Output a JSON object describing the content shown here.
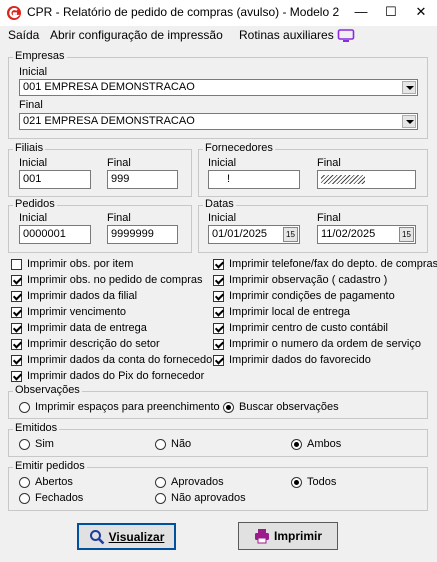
{
  "window": {
    "title": "CPR - Relatório de pedido de compras (avulso) - Modelo 2",
    "minimize": "—",
    "maximize": "☐",
    "close": "✕"
  },
  "menu": {
    "items": [
      "Saída",
      "Abrir configuração de impressão",
      "Rotinas auxiliares"
    ]
  },
  "empresas": {
    "legend": "Empresas",
    "inicial_label": "Inicial",
    "inicial_value": "001 EMPRESA DEMONSTRACAO",
    "final_label": "Final",
    "final_value": "021 EMPRESA DEMONSTRACAO"
  },
  "filiais": {
    "legend": "Filiais",
    "inicial_label": "Inicial",
    "inicial_value": "001",
    "final_label": "Final",
    "final_value": "999"
  },
  "fornecedores": {
    "legend": "Fornecedores",
    "inicial_label": "Inicial",
    "inicial_value": "!",
    "final_label": "Final",
    "final_value": ""
  },
  "pedidos": {
    "legend": "Pedidos",
    "inicial_label": "Inicial",
    "inicial_value": "0000001",
    "final_label": "Final",
    "final_value": "9999999"
  },
  "datas": {
    "legend": "Datas",
    "inicial_label": "Inicial",
    "inicial_value": "01/01/2025",
    "final_label": "Final",
    "final_value": "11/02/2025",
    "cal_icon": "15"
  },
  "checks_left": [
    {
      "label": "Imprimir obs. por item",
      "checked": false
    },
    {
      "label": "Imprimir obs. no pedido de compras",
      "checked": true
    },
    {
      "label": "Imprimir dados da filial",
      "checked": true
    },
    {
      "label": "Imprimir vencimento",
      "checked": true
    },
    {
      "label": "Imprimir data de entrega",
      "checked": true
    },
    {
      "label": "Imprimir descrição do setor",
      "checked": true
    },
    {
      "label": "Imprimir dados da conta do fornecedor",
      "checked": true
    },
    {
      "label": "Imprimir dados do Pix do fornecedor",
      "checked": true
    }
  ],
  "checks_right": [
    {
      "label": "Imprimir telefone/fax do depto. de compras",
      "checked": true
    },
    {
      "label": "Imprimir observação ( cadastro )",
      "checked": true
    },
    {
      "label": "Imprimir condições de pagamento",
      "checked": true
    },
    {
      "label": "Imprimir local de entrega",
      "checked": true
    },
    {
      "label": "Imprimir centro de custo contábil",
      "checked": true
    },
    {
      "label": "Imprimir o numero da ordem de serviço",
      "checked": true
    },
    {
      "label": "Imprimir dados do favorecido",
      "checked": true
    }
  ],
  "observacoes": {
    "legend": "Observações",
    "opt1": "Imprimir espaços para preenchimento",
    "opt2": "Buscar observações",
    "selected": 2
  },
  "emitidos": {
    "legend": "Emitidos",
    "opt1": "Sim",
    "opt2": "Não",
    "opt3": "Ambos",
    "selected": 3
  },
  "emitir": {
    "legend": "Emitir pedidos",
    "abertos": "Abertos",
    "aprovados": "Aprovados",
    "todos": "Todos",
    "fechados": "Fechados",
    "nao_aprovados": "Não aprovados",
    "selected": "todos"
  },
  "buttons": {
    "visualizar": "Visualizar",
    "imprimir": "Imprimir"
  },
  "colors": {
    "brand_red": "#d9261c",
    "monitor_icon": "#8a2be2",
    "print_icon": "#9b1a8c",
    "search_icon": "#1a3fa0"
  }
}
